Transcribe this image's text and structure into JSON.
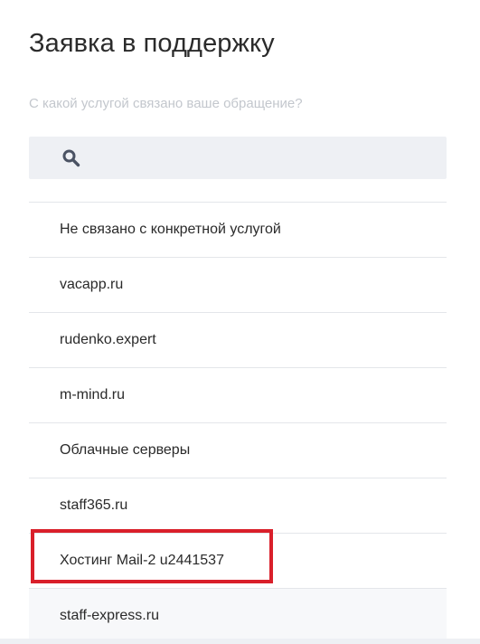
{
  "dialog": {
    "title": "Заявка в поддержку",
    "question": "С какой услугой связано ваше обращение?"
  },
  "search": {
    "value": "",
    "placeholder": "",
    "icon": "search-icon"
  },
  "services": [
    {
      "label": "Не связано с конкретной услугой"
    },
    {
      "label": "vacapp.ru"
    },
    {
      "label": "rudenko.expert"
    },
    {
      "label": "m-mind.ru"
    },
    {
      "label": "Облачные серверы"
    },
    {
      "label": "staff365.ru"
    },
    {
      "label": "Хостинг Mail-2 u2441537"
    },
    {
      "label": "staff-express.ru"
    }
  ],
  "colors": {
    "highlight_frame": "#d91f2a",
    "search_background": "#eef0f4",
    "question_text": "#c3c7cd"
  }
}
